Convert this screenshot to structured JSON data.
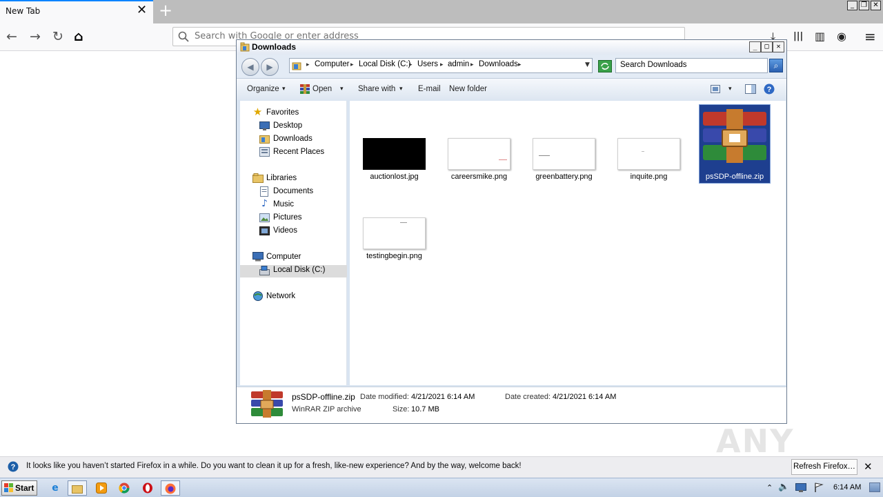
{
  "browser": {
    "tab_title": "New Tab",
    "tab_close": "✕",
    "new_tab": "+",
    "url_placeholder": "Search with Google or enter address",
    "nav": {
      "back": "←",
      "forward": "→",
      "reload": "↻",
      "home": "⌂"
    },
    "right_icons": {
      "download": "⤓",
      "library": "|||",
      "sidebar": "▥",
      "account": "◉",
      "menu": "≡"
    },
    "window_controls": {
      "minimize": "_",
      "restore": "❐",
      "close": "✕"
    }
  },
  "explorer": {
    "title": "Downloads",
    "controls": {
      "minimize": "_",
      "maximize": "□",
      "close": "✕"
    },
    "breadcrumbs": [
      "Computer",
      "Local Disk (C:)",
      "Users",
      "admin",
      "Downloads"
    ],
    "search_placeholder": "Search Downloads",
    "toolbar": {
      "organize": "Organize",
      "open": "Open",
      "share_with": "Share with",
      "email": "E-mail",
      "new_folder": "New folder",
      "dropdown": "▾"
    },
    "nav_pane": {
      "favorites": "Favorites",
      "desktop": "Desktop",
      "downloads": "Downloads",
      "recent_places": "Recent Places",
      "libraries": "Libraries",
      "documents": "Documents",
      "music": "Music",
      "pictures": "Pictures",
      "videos": "Videos",
      "computer": "Computer",
      "local_disk": "Local Disk (C:)",
      "network": "Network"
    },
    "files": [
      {
        "name": "auctionlost.jpg"
      },
      {
        "name": "careersmike.png"
      },
      {
        "name": "greenbattery.png"
      },
      {
        "name": "inquite.png"
      },
      {
        "name": "psSDP-offline.zip"
      },
      {
        "name": "testingbegin.png"
      }
    ],
    "details": {
      "name": "psSDP-offline.zip",
      "type": "WinRAR ZIP archive",
      "modified_label": "Date modified:",
      "modified_value": "4/21/2021 6:14 AM",
      "created_label": "Date created:",
      "created_value": "4/21/2021 6:14 AM",
      "size_label": "Size:",
      "size_value": "10.7 MB"
    }
  },
  "notification": {
    "text": "It looks like you haven’t started Firefox in a while. Do you want to clean it up for a fresh, like-new experience? And by the way, welcome back!",
    "button": "Refresh Firefox…",
    "close": "✕",
    "info_icon": "?"
  },
  "taskbar": {
    "start": "Start",
    "time": "6:14 AM",
    "watermark": "ANY RUN"
  },
  "colors": {
    "selection": "#1e3f8f",
    "title_bar": "#e2e9f3",
    "taskbar": "#c3d2e6"
  }
}
